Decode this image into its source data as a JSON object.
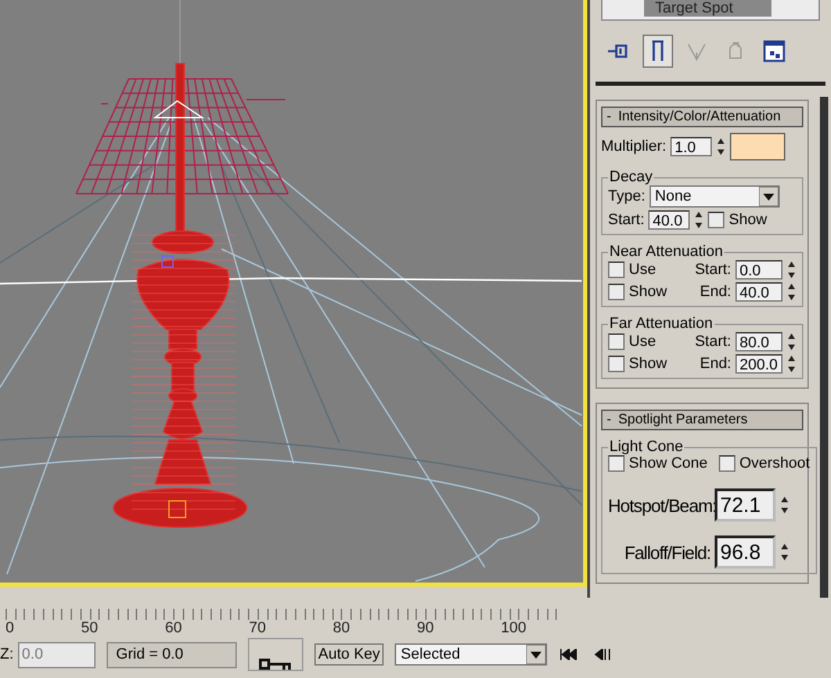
{
  "viewport": {
    "active": true
  },
  "command_panel": {
    "object_name": "Target Spot",
    "toolbar": [
      {
        "kind": "pin",
        "selected": false,
        "disabled": false
      },
      {
        "kind": "stack",
        "selected": true,
        "disabled": false
      },
      {
        "kind": "funnel",
        "selected": false,
        "disabled": true
      },
      {
        "kind": "lock",
        "selected": false,
        "disabled": true
      },
      {
        "kind": "config",
        "selected": false,
        "disabled": false
      }
    ]
  },
  "intensity": {
    "toggle": "-",
    "title": "Intensity/Color/Attenuation",
    "multiplier_label": "Multiplier:",
    "multiplier_value": "1.0",
    "color": "#fedcb2",
    "decay": {
      "title": "Decay",
      "type_label": "Type:",
      "type_value": "None",
      "start_label": "Start:",
      "start_value": "40.0",
      "show": {
        "label": "Show",
        "checked": false
      }
    },
    "attenuation": [
      {
        "title": "Near Attenuation",
        "use": {
          "label": "Use",
          "checked": false
        },
        "show": {
          "label": "Show",
          "checked": false
        },
        "start_label": "Start:",
        "start_value": "0.0",
        "end_label": "End:",
        "end_value": "40.0"
      },
      {
        "title": "Far Attenuation",
        "use": {
          "label": "Use",
          "checked": false
        },
        "show": {
          "label": "Show",
          "checked": false
        },
        "start_label": "Start:",
        "start_value": "80.0",
        "end_label": "End:",
        "end_value": "200.0"
      }
    ]
  },
  "spotlight": {
    "toggle": "-",
    "title": "Spotlight Parameters",
    "light_cone": {
      "title": "Light Cone",
      "show_cone": {
        "label": "Show Cone",
        "checked": false
      },
      "overshoot": {
        "label": "Overshoot",
        "checked": false
      },
      "hotspot_label": "Hotspot/Beam:",
      "hotspot_value": "72.1",
      "falloff_label": "Falloff/Field:",
      "falloff_value": "96.8"
    }
  },
  "timeline": {
    "ticks": [
      "0",
      "50",
      "60",
      "70",
      "80",
      "90",
      "100"
    ]
  },
  "status_bar": {
    "z_label": "Z:",
    "z_value": "0.0",
    "grid": "Grid = 0.0",
    "auto_key": {
      "label": "Auto Key",
      "on": false
    },
    "key_filter": "Selected"
  }
}
